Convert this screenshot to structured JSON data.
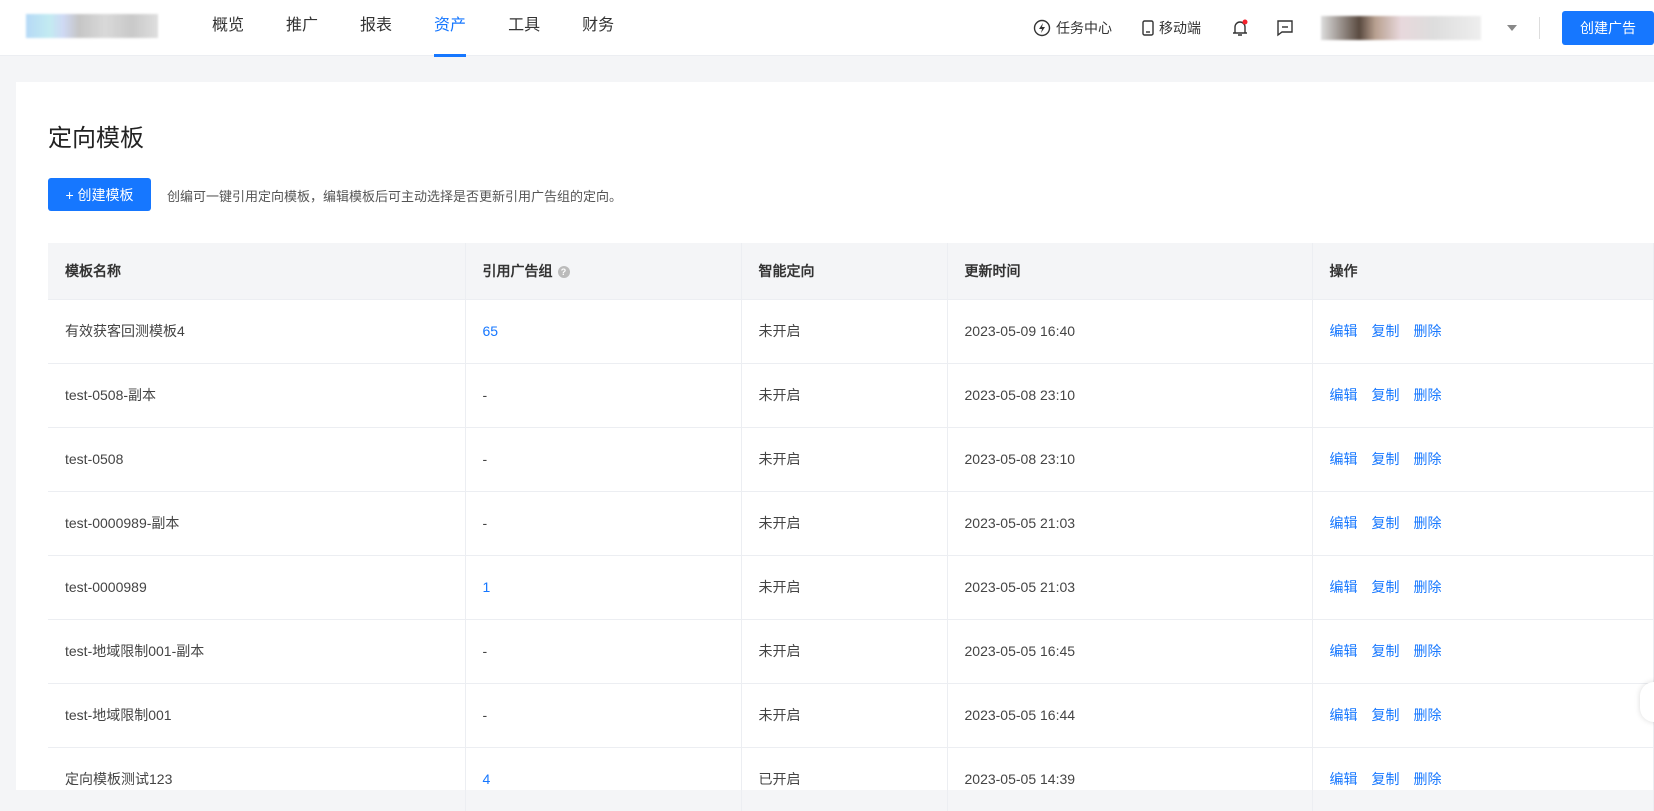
{
  "nav": {
    "items": [
      {
        "label": "概览"
      },
      {
        "label": "推广"
      },
      {
        "label": "报表"
      },
      {
        "label": "资产"
      },
      {
        "label": "工具"
      },
      {
        "label": "财务"
      }
    ],
    "active": "资产"
  },
  "header": {
    "task_center": "任务中心",
    "mobile": "移动端",
    "create_ad": "创建广告"
  },
  "page": {
    "title": "定向模板",
    "create_button": "+ 创建模板",
    "description": "创编可一键引用定向模板，编辑模板后可主动选择是否更新引用广告组的定向。"
  },
  "table": {
    "columns": [
      "模板名称",
      "引用广告组",
      "智能定向",
      "更新时间",
      "操作"
    ],
    "actions": [
      "编辑",
      "复制",
      "删除"
    ],
    "rows": [
      {
        "name": "有效获客回测模板4",
        "ref": "65",
        "smart": "未开启",
        "time": "2023-05-09 16:40"
      },
      {
        "name": "test-0508-副本",
        "ref": "-",
        "smart": "未开启",
        "time": "2023-05-08 23:10"
      },
      {
        "name": "test-0508",
        "ref": "-",
        "smart": "未开启",
        "time": "2023-05-08 23:10"
      },
      {
        "name": "test-0000989-副本",
        "ref": "-",
        "smart": "未开启",
        "time": "2023-05-05 21:03"
      },
      {
        "name": "test-0000989",
        "ref": "1",
        "smart": "未开启",
        "time": "2023-05-05 21:03"
      },
      {
        "name": "test-地域限制001-副本",
        "ref": "-",
        "smart": "未开启",
        "time": "2023-05-05 16:45"
      },
      {
        "name": "test-地域限制001",
        "ref": "-",
        "smart": "未开启",
        "time": "2023-05-05 16:44"
      },
      {
        "name": "定向模板测试123",
        "ref": "4",
        "smart": "已开启",
        "time": "2023-05-05 14:39"
      }
    ]
  },
  "colors": {
    "accent": "#1677ff",
    "badge": "#f5222d"
  }
}
